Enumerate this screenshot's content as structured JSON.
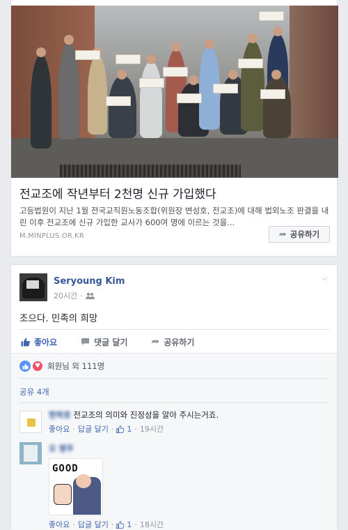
{
  "link_preview": {
    "title": "전교조에 작년부터 2천명 신규 가입했다",
    "description": "고등법원이 지난 1월 전국교직원노동조합(위원장 변성호, 전교조)에 대해 법외노조 판결을 내린 이후 전교조에 신규 가입한 교사가 600여 명에 이르는 것을...",
    "domain": "M.MINPLUS.OR.KR",
    "share_button": "공유하기",
    "image_icon": "group-photo"
  },
  "post": {
    "author": "Seryoung Kim",
    "time": "20시간",
    "audience_icon": "friends-icon",
    "text": "조으다. 민족의 희망",
    "actions": {
      "like": "좋아요",
      "comment": "댓글 달기",
      "share": "공유하기"
    },
    "reactions_text": "회원님 외 111명",
    "share_count": "공유 4개"
  },
  "comments": [
    {
      "author": "한하호",
      "text": "전교조의 의미와 진정성을 알아 주시는거죠.",
      "like_action": "좋아요",
      "reply_action": "답글 달기",
      "like_count": "1",
      "time": "19시간"
    },
    {
      "author": "오 명주",
      "sticker_text": "GOOD",
      "like_action": "좋아요",
      "reply_action": "답글 달기",
      "like_count": "1",
      "time": "18시간"
    }
  ],
  "colors": {
    "link_blue": "#365899",
    "action_blue": "#4267b2",
    "muted": "#90949c",
    "background": "#e9ebee"
  }
}
